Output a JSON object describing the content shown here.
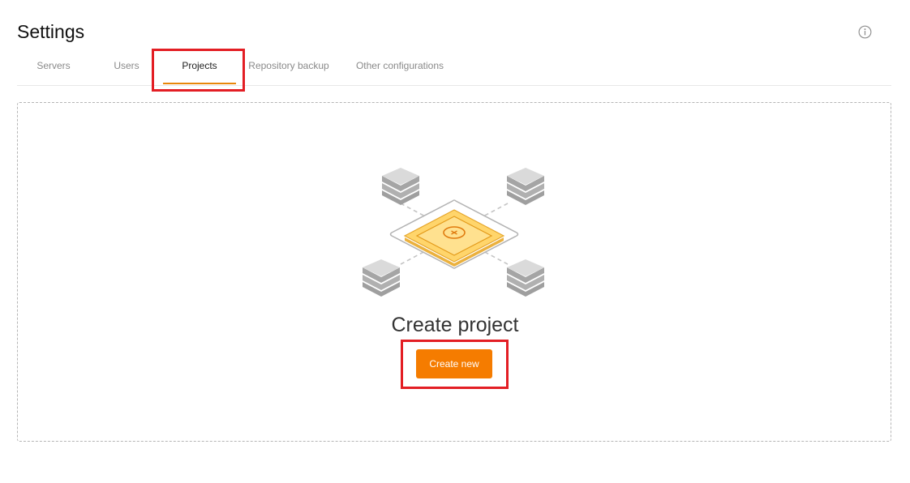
{
  "page": {
    "title": "Settings"
  },
  "icons": {
    "info": "info-icon",
    "illustration": "project-network-illustration"
  },
  "tabs": [
    {
      "label": "Servers",
      "active": false
    },
    {
      "label": "Users",
      "active": false
    },
    {
      "label": "Projects",
      "active": true
    },
    {
      "label": "Repository backup",
      "active": false
    },
    {
      "label": "Other configurations",
      "active": false
    }
  ],
  "empty_state": {
    "title": "Create project",
    "button_label": "Create new"
  },
  "colors": {
    "accent": "#f57c00",
    "tab_underline": "#e8870a",
    "highlight": "#e31e24",
    "muted_text": "#8a8a8a"
  }
}
